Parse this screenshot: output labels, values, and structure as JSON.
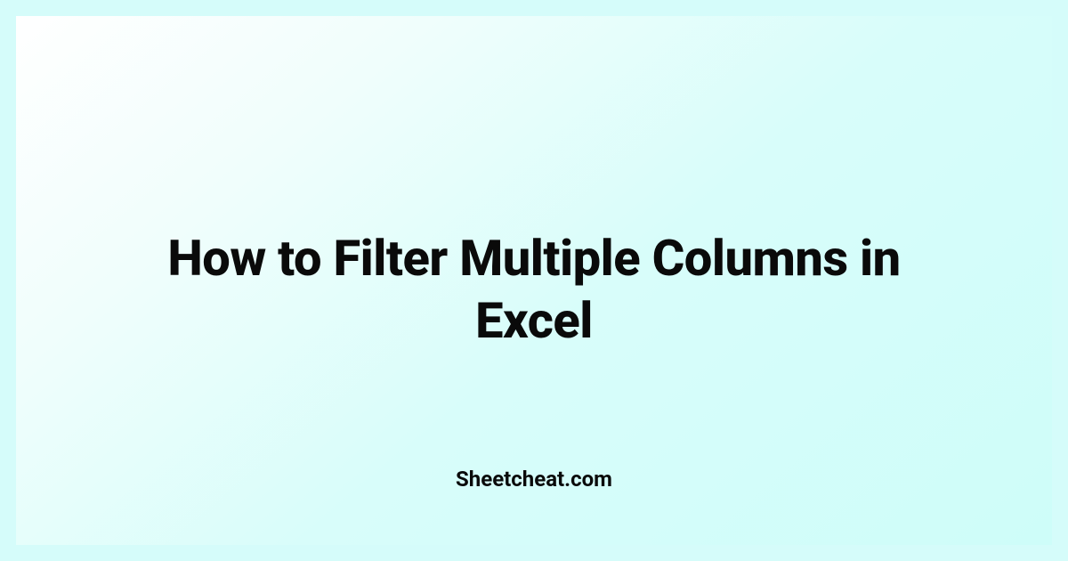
{
  "main": {
    "title": "How to Filter Multiple Columns in Excel",
    "site": "Sheetcheat.com"
  }
}
